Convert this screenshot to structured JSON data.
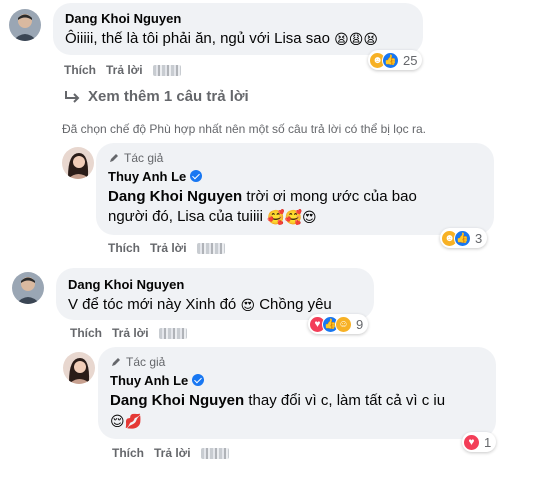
{
  "comments": [
    {
      "author": "Dang Khoi Nguyen",
      "text": "Ôiiiii, thế là tôi phải ăn, ngủ với Lisa sao",
      "emoji": "😫😩😫",
      "like_label": "Thích",
      "reply_label": "Trả lời",
      "reaction_count": "25",
      "reaction_icons": [
        "haha-icon",
        "like-icon"
      ]
    },
    {
      "author": "Dang Khoi Nguyen",
      "text": "V để tóc mới này Xinh đó",
      "emoji_mid": "😍",
      "text_tail": "Chồng yêu",
      "like_label": "Thích",
      "reply_label": "Trả lời",
      "reaction_count": "9",
      "reaction_icons": [
        "love-icon",
        "like-icon",
        "care-icon"
      ]
    }
  ],
  "replies": [
    {
      "badge": "Tác giả",
      "author": "Thuy Anh Le",
      "mention": "Dang Khoi Nguyen",
      "text_a": "trời ơi mong ước của bao",
      "text_b": "người đó, Lisa của tuiiii",
      "emoji": "🥰🥰😍",
      "like_label": "Thích",
      "reply_label": "Trả lời",
      "reaction_count": "3",
      "reaction_icons": [
        "haha-icon",
        "like-icon"
      ]
    },
    {
      "badge": "Tác giả",
      "author": "Thuy Anh Le",
      "mention": "Dang Khoi Nguyen",
      "text_a": "thay đổi vì c, làm tất cả vì c iu",
      "emoji": "😌💋",
      "like_label": "Thích",
      "reply_label": "Trả lời",
      "reaction_count": "1",
      "reaction_icons": [
        "love-icon"
      ]
    }
  ],
  "see_more": "Xem thêm 1 câu trả lời",
  "filter_notice": "Đã chọn chế độ Phù hợp nhất nên một số câu trả lời có thể bị lọc ra.",
  "colors": {
    "bubble": "#f0f2f5",
    "meta": "#65676b",
    "like_blue": "#1877f2",
    "love_red": "#f33e58",
    "haha_yellow": "#f7b125"
  }
}
